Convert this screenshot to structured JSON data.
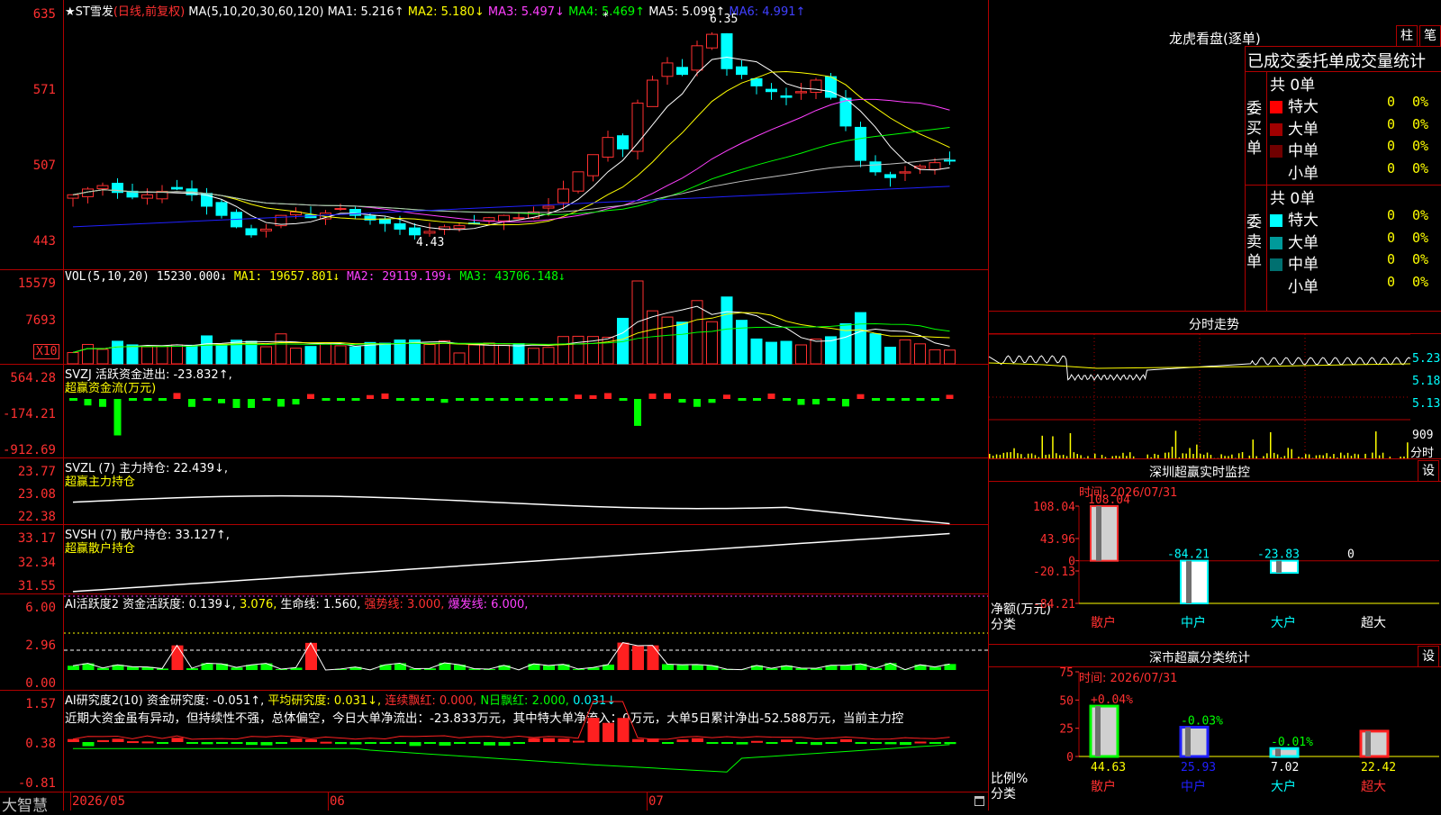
{
  "kline": {
    "title_symbol": "★ST雪发",
    "title_mode": "(日线,前复权)",
    "ma_params": "MA(5,10,20,30,60,120)",
    "ma1_label": "MA1: 5.216↑",
    "ma2_label": "MA2: 5.180↓",
    "ma3_label": "MA3: 5.497↓",
    "ma4_label": "MA4: 5.469↑",
    "ma5_label": "MA5: 5.099↑",
    "ma6_label": "MA6: 4.991↑",
    "high_marker": "6.35",
    "low_marker": "4.43",
    "y_labels": [
      "635",
      "571",
      "507",
      "443"
    ]
  },
  "vol": {
    "title_params": "VOL(5,10,20)",
    "value": "15230.000↓",
    "ma1": "MA1: 19657.801↓",
    "ma2": "MA2: 29119.199↓",
    "ma3": "MA3: 43706.148↓",
    "y_labels": [
      "15579",
      "7693"
    ],
    "unit_badge": "X10"
  },
  "svzj": {
    "title": "SVZJ  活跃资金进出: -23.832↑,",
    "subtitle": "超赢资金流(万元)",
    "y_labels": [
      "564.28",
      "-174.21",
      "-912.69"
    ]
  },
  "svzl": {
    "title": "SVZL (7) 主力持仓: 22.439↓,",
    "subtitle": "超赢主力持仓",
    "y_labels": [
      "23.77",
      "23.08",
      "22.38"
    ]
  },
  "svsh": {
    "title": "SVSH (7) 散户持仓: 33.127↑,",
    "subtitle": "超赢散户持仓",
    "y_labels": [
      "33.17",
      "32.34",
      "31.55"
    ]
  },
  "ai1": {
    "title_a": "AI活跃度2 资金活跃度: 0.139↓,",
    "title_b": "3.076,",
    "title_c": "生命线: 1.560,",
    "title_d": "强势线: 3.000,",
    "title_e": "爆发线: 6.000,",
    "y_labels": [
      "6.00",
      "2.96",
      "0.00"
    ]
  },
  "ai2": {
    "title_a": "AI研究度2(10) 资金研究度: -0.051↑,",
    "title_b": "平均研究度: 0.031↓,",
    "title_c": "连续飘红: 0.000,",
    "title_d": "N日飘红: 2.000,",
    "title_e": "0.031↓",
    "comment": "近期大资金虽有异动，但持续性不强，总体偏空，今日大单净流出：-23.833万元，其中特大单净流入：0万元，大单5日累计净出-52.588万元，当前主力控",
    "y_labels": [
      "1.57",
      "0.38",
      "-0.81"
    ]
  },
  "footer": {
    "brand": "大智慧",
    "dates": [
      "2026/05",
      "06",
      "07"
    ]
  },
  "longhu": {
    "title": "龙虎看盘(逐单)",
    "btn1": "柱",
    "btn2": "笔",
    "header": "已成交委托单成交量统计",
    "buy_side": "委买单",
    "sell_side": "委卖单",
    "buy_total": "共 0单",
    "sell_total": "共 0单",
    "buy_rows": [
      {
        "label": "特大",
        "count": "0",
        "pct": "0%",
        "color": "#ff0000"
      },
      {
        "label": "大单",
        "count": "0",
        "pct": "0%",
        "color": "#a00000"
      },
      {
        "label": "中单",
        "count": "0",
        "pct": "0%",
        "color": "#700000"
      },
      {
        "label": "小单",
        "count": "0",
        "pct": "0%",
        "color": "#000000"
      }
    ],
    "sell_rows": [
      {
        "label": "特大",
        "count": "0",
        "pct": "0%",
        "color": "#00ffff"
      },
      {
        "label": "大单",
        "count": "0",
        "pct": "0%",
        "color": "#009a9a"
      },
      {
        "label": "中单",
        "count": "0",
        "pct": "0%",
        "color": "#007070"
      },
      {
        "label": "小单",
        "count": "0",
        "pct": "0%",
        "color": "#000000"
      }
    ]
  },
  "intraday": {
    "title": "分时走势",
    "y_labels": [
      "5.23",
      "5.18",
      "5.13"
    ],
    "vol_label": "909",
    "vol_unit": "分时"
  },
  "monitor": {
    "title": "深圳超赢实时监控",
    "btn": "设",
    "time": "时间: 2026/07/31",
    "y_labels": [
      "108.04",
      "43.96",
      "0",
      "-20.13",
      "-84.21"
    ],
    "left_label1": "净额(万元)",
    "left_label2": "分类",
    "bars": [
      {
        "cat": "散户",
        "value": 108.04,
        "label": "108.04",
        "color": "#ff3030"
      },
      {
        "cat": "中户",
        "value": -84.21,
        "label": "-84.21",
        "color": "#00ffff"
      },
      {
        "cat": "大户",
        "value": -23.83,
        "label": "-23.83",
        "color": "#00ffff"
      },
      {
        "cat": "超大",
        "value": 0,
        "label": "0",
        "color": "#ffffff"
      }
    ]
  },
  "classify": {
    "title": "深市超赢分类统计",
    "btn": "设",
    "time": "时间: 2026/07/31",
    "y_labels": [
      "75",
      "50",
      "25",
      "0"
    ],
    "left_label1": "比例%",
    "left_label2": "分类",
    "bars": [
      {
        "cat": "散户",
        "value": 44.63,
        "label": "44.63",
        "delta": "+0.04%",
        "color": "#00ff00",
        "delta_color": "#ff3030"
      },
      {
        "cat": "中户",
        "value": 25.93,
        "label": "25.93",
        "delta": "-0.03%",
        "color": "#2020ff",
        "delta_color": "#00ff00"
      },
      {
        "cat": "大户",
        "value": 7.02,
        "label": "7.02",
        "delta": "-0.01%",
        "color": "#00ffff",
        "delta_color": "#00ff00"
      },
      {
        "cat": "超大",
        "value": 22.42,
        "label": "22.42",
        "delta": "",
        "color": "#ff2020",
        "delta_color": "#ff3030"
      }
    ]
  }
}
